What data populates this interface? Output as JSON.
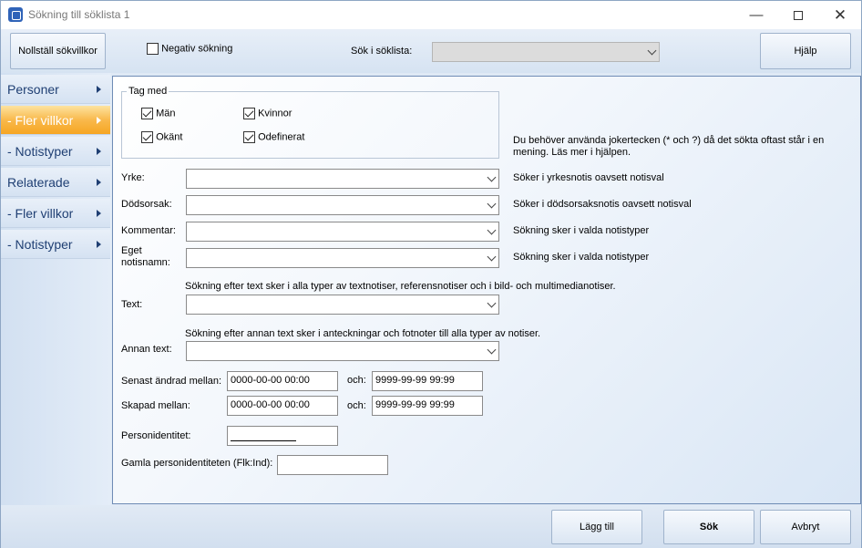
{
  "window": {
    "title": "Sökning till söklista 1"
  },
  "toolbar": {
    "reset_label": "Nollställ sökvillkor",
    "negative_label": "Negativ sökning",
    "search_in_label": "Sök i söklista:",
    "help_label": "Hjälp"
  },
  "sidebar": {
    "items": [
      {
        "label": "Personer"
      },
      {
        "label": "- Fler villkor"
      },
      {
        "label": "- Notistyper"
      },
      {
        "label": "Relaterade"
      },
      {
        "label": "- Fler villkor"
      },
      {
        "label": "- Notistyper"
      }
    ]
  },
  "include": {
    "title": "Tag med",
    "men": "Män",
    "women": "Kvinnor",
    "unknown": "Okänt",
    "undefined": "Odefinerat"
  },
  "hint": "Du behöver använda jokertecken (* och ?) då det sökta oftast står i en mening. Läs mer i hjälpen.",
  "fields": {
    "occupation_label": "Yrke:",
    "occupation_hint": "Söker i yrkesnotis oavsett notisval",
    "death_label": "Dödsorsak:",
    "death_hint": "Söker i dödsorsaksnotis oavsett notisval",
    "comment_label": "Kommentar:",
    "comment_hint": "Sökning sker i valda notistyper",
    "own_label": "Eget notisnamn:",
    "own_hint": "Sökning sker i valda notistyper",
    "text_info": "Sökning efter text sker i alla typer av textnotiser, referensnotiser och i bild- och multimedianotiser.",
    "text_label": "Text:",
    "other_info": "Sökning efter annan text sker i anteckningar och fotnoter till alla typer av notiser.",
    "other_label": "Annan text:",
    "changed_label": "Senast ändrad mellan:",
    "changed_from": "0000-00-00 00:00",
    "and_label": "och:",
    "changed_to": "9999-99-99 99:99",
    "created_label": "Skapad mellan:",
    "created_from": "0000-00-00 00:00",
    "created_to": "9999-99-99 99:99",
    "pid_label": "Personidentitet:",
    "old_pid_label": "Gamla personidentiteten (Flk:Ind):"
  },
  "footer": {
    "add_label": "Lägg till",
    "search_label": "Sök",
    "cancel_label": "Avbryt"
  }
}
